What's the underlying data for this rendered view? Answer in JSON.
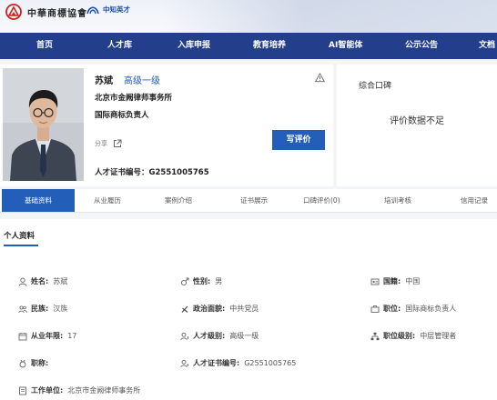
{
  "header": {
    "org_name": "中華商標協會",
    "partner_name": "中知英才"
  },
  "nav": [
    "首页",
    "人才库",
    "入库申报",
    "教育培养",
    "AI智能体",
    "公示公告",
    "文档"
  ],
  "profile": {
    "name": "苏斌",
    "level": "高级一级",
    "org": "北京市金阙律师事务所",
    "role": "国际商标负责人",
    "share_label": "分享",
    "write_review": "写评价",
    "cert_label": "人才证书编号：",
    "cert_no": "G2551005765"
  },
  "reputation": {
    "title": "综合口碑",
    "empty": "评价数据不足"
  },
  "tabs": [
    "基础资料",
    "从业履历",
    "案例介绍",
    "证书展示",
    "口碑评价(0)",
    "培训考核",
    "信用记录"
  ],
  "section_title": "个人资料",
  "fields": {
    "name": {
      "label": "姓名:",
      "value": "苏斌"
    },
    "gender": {
      "label": "性别:",
      "value": "男"
    },
    "nation": {
      "label": "国籍:",
      "value": "中国"
    },
    "ethnic": {
      "label": "民族:",
      "value": "汉族"
    },
    "party": {
      "label": "政治面貌:",
      "value": "中共党员"
    },
    "job": {
      "label": "职位:",
      "value": "国际商标负责人"
    },
    "years": {
      "label": "从业年限:",
      "value": "17"
    },
    "tlevel": {
      "label": "人才级别:",
      "value": "高级一级"
    },
    "plevel": {
      "label": "职位级别:",
      "value": "中层管理者"
    },
    "title": {
      "label": "职称:",
      "value": ""
    },
    "cert": {
      "label": "人才证书编号:",
      "value": "G2551005765"
    },
    "unit": {
      "label": "工作单位:",
      "value": "北京市金阙律师事务所"
    }
  },
  "colors": {
    "nav_bg": "#233e8b",
    "accent": "#235fb8",
    "logo_red": "#c8261e"
  }
}
